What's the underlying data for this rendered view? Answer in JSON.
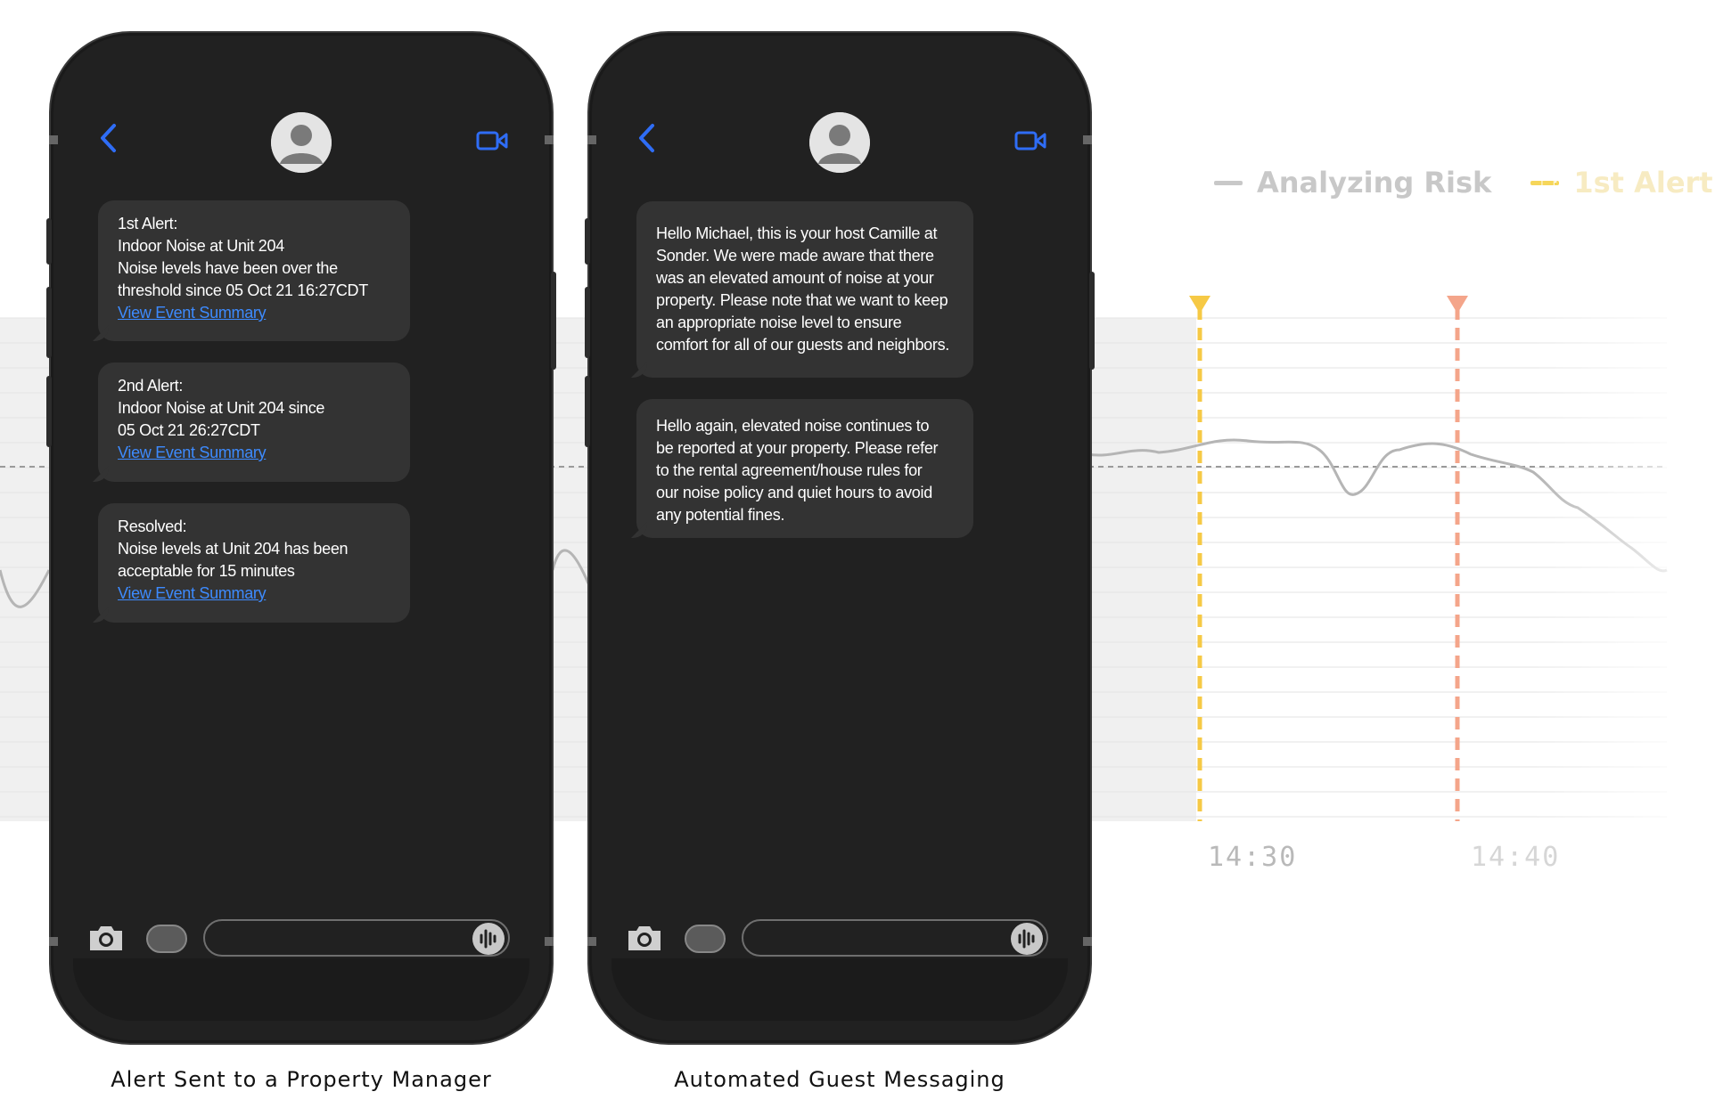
{
  "background_chart": {
    "legend": [
      {
        "label": "Analyzing Risk",
        "color": "#c8c8c8",
        "style": "solid"
      },
      {
        "label": "1st Alert",
        "color": "#f6d65a",
        "style": "dashed"
      }
    ],
    "markers": [
      {
        "time": "14:30",
        "color": "#f6c945"
      },
      {
        "time": "14:40",
        "color": "#f4a58a"
      }
    ],
    "time_labels": [
      "14:30",
      "14:40"
    ]
  },
  "phone_manager": {
    "caption": "Alert Sent to a Property Manager",
    "messages": [
      {
        "lines": [
          "1st Alert:",
          "Indoor Noise at Unit 204",
          "Noise levels have been over the",
          "threshold since 05 Oct 21 16:27CDT"
        ],
        "link": "View Event Summary"
      },
      {
        "lines": [
          "2nd Alert:",
          "Indoor Noise at Unit 204 since",
          "05 Oct 21 26:27CDT"
        ],
        "link": "View Event Summary"
      },
      {
        "lines": [
          "Resolved:",
          "Noise levels at Unit 204 has been",
          "acceptable for 15 minutes"
        ],
        "link": "View Event Summary"
      }
    ]
  },
  "phone_guest": {
    "caption": "Automated Guest Messaging",
    "messages": [
      {
        "lines": [
          "Hello Michael, this is your host Camille at",
          "Sonder. We were made aware that there",
          "was an elevated amount of noise at your",
          "property. Please note that we want to keep",
          "an appropriate noise level to ensure",
          "comfort for all of our guests and neighbors."
        ]
      },
      {
        "lines": [
          "Hello again, elevated noise continues to",
          "be reported at your property. Please refer",
          "to the rental agreement/house rules for",
          "our noise policy and quiet hours to avoid",
          "any potential fines."
        ]
      }
    ]
  },
  "colors": {
    "accent_blue": "#2f6df6",
    "bubble": "#333333",
    "phone_body": "#212121"
  }
}
